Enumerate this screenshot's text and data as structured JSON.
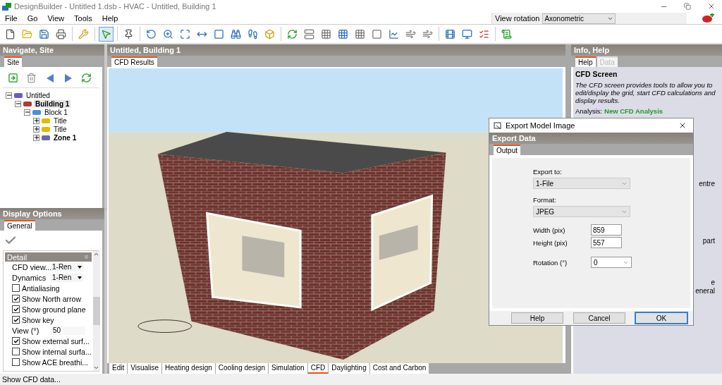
{
  "window": {
    "title": "DesignBuilder - Untitled 1.dsb - HVAC - Untitled, Building 1"
  },
  "menu": [
    "File",
    "Go",
    "View",
    "Tools",
    "Help"
  ],
  "view_rotation": {
    "label": "View rotation",
    "value": "Axonometric"
  },
  "navigate": {
    "title": "Navigate, Site",
    "tabs": [
      {
        "label": "Site",
        "selected": true
      }
    ],
    "tree": [
      {
        "label": "Untitled",
        "kind": "site",
        "bold": false,
        "selected": false,
        "expanded": true,
        "children": [
          {
            "label": "Building 1",
            "kind": "building",
            "bold": true,
            "selected": true,
            "expanded": true,
            "children": [
              {
                "label": "Block 1",
                "kind": "block",
                "bold": false,
                "selected": false,
                "expanded": true,
                "children": [
                  {
                    "label": "Title",
                    "kind": "surface",
                    "bold": false,
                    "selected": false,
                    "expanded": false
                  },
                  {
                    "label": "Title",
                    "kind": "surface",
                    "bold": false,
                    "selected": false,
                    "expanded": false
                  },
                  {
                    "label": "Zone 1",
                    "kind": "zone",
                    "bold": true,
                    "selected": false,
                    "expanded": false
                  }
                ]
              }
            ]
          }
        ]
      }
    ]
  },
  "display_options": {
    "title": "Display Options",
    "tabs": [
      {
        "label": "General",
        "selected": true
      }
    ],
    "section": "Detail",
    "rows": [
      {
        "kind": "select",
        "label": "CFD view...",
        "value": "1-Ren"
      },
      {
        "kind": "select",
        "label": "Dynamics",
        "value": "1-Ren"
      },
      {
        "kind": "checkbox",
        "label": "Antialiasing",
        "checked": false
      },
      {
        "kind": "checkbox",
        "label": "Show North arrow",
        "checked": true
      },
      {
        "kind": "checkbox",
        "label": "Show ground plane",
        "checked": true
      },
      {
        "kind": "checkbox",
        "label": "Show key",
        "checked": true
      },
      {
        "kind": "input",
        "label": "View (°)",
        "value": "50"
      },
      {
        "kind": "checkbox",
        "label": "Show external surf...",
        "checked": true
      },
      {
        "kind": "checkbox",
        "label": "Show internal surfa...",
        "checked": false
      },
      {
        "kind": "checkbox",
        "label": "Show ACE breathi...",
        "checked": false
      }
    ]
  },
  "viewport": {
    "title": "Untitled, Building 1",
    "tabs": [
      {
        "label": "CFD Results",
        "selected": true
      }
    ]
  },
  "bottom_tabs": [
    {
      "label": "Edit",
      "selected": false
    },
    {
      "label": "Visualise",
      "selected": false
    },
    {
      "label": "Heating design",
      "selected": false
    },
    {
      "label": "Cooling design",
      "selected": false
    },
    {
      "label": "Simulation",
      "selected": false
    },
    {
      "label": "CFD",
      "selected": true
    },
    {
      "label": "Daylighting",
      "selected": false
    },
    {
      "label": "Cost and Carbon",
      "selected": false
    }
  ],
  "info": {
    "title": "Info, Help",
    "tabs": [
      {
        "label": "Help",
        "selected": true,
        "disabled": false
      },
      {
        "label": "Data",
        "selected": false,
        "disabled": true
      }
    ],
    "heading": "CFD Screen",
    "description": "The CFD screen provides tools to allow you to edit/display the grid, start CFD calculations and display results.",
    "analysis_label": "Analysis:",
    "analysis_value": "New CFD Analysis",
    "fragments": [
      "entre",
      "part",
      "e",
      "eneral"
    ]
  },
  "dialog": {
    "title": "Export Model Image",
    "header": "Export Data",
    "tabs": [
      {
        "label": "Output",
        "selected": true
      }
    ],
    "fields": [
      {
        "kind": "dropdown",
        "label": "Export to:",
        "value": "1-File"
      },
      {
        "kind": "dropdown",
        "label": "Format:",
        "value": "JPEG"
      },
      {
        "kind": "input",
        "label": "Width (pix)",
        "value": "859"
      },
      {
        "kind": "input",
        "label": "Height (pix)",
        "value": "557"
      },
      {
        "kind": "inline-dropdown",
        "label": "Rotation (°)",
        "value": "0"
      }
    ],
    "buttons": [
      {
        "label": "Help",
        "default": false
      },
      {
        "label": "Cancel",
        "default": false
      },
      {
        "label": "OK",
        "default": true
      }
    ]
  },
  "status_bar": {
    "text": "Show CFD data..."
  }
}
